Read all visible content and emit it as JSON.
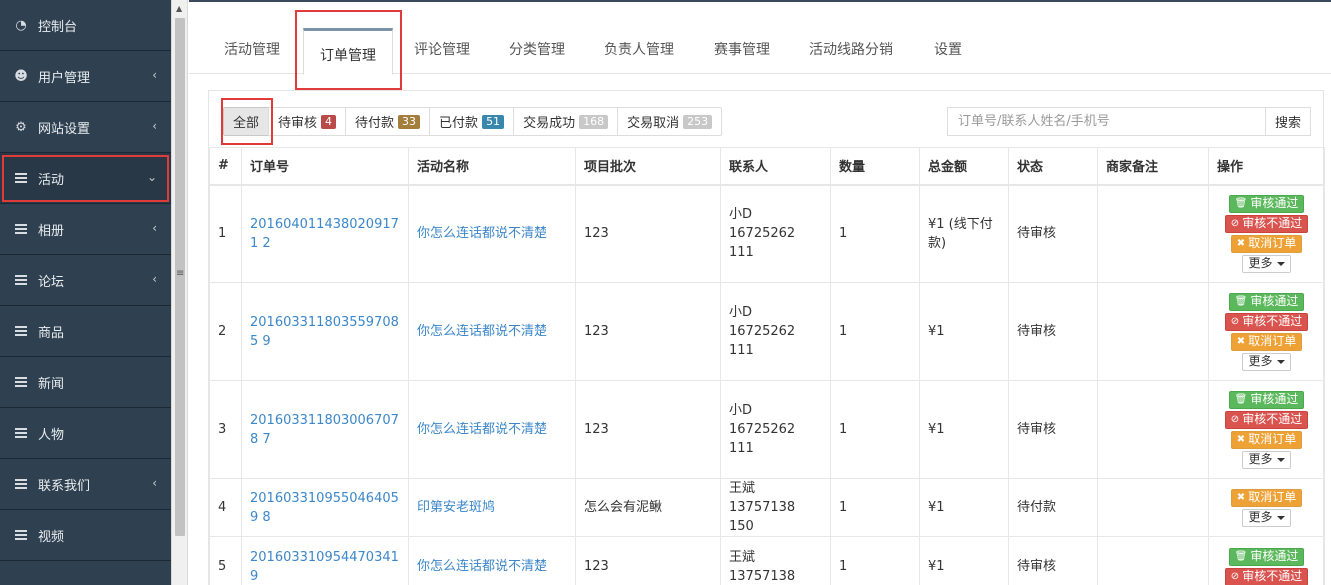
{
  "sidebar": {
    "items": [
      {
        "label": "控制台",
        "icon": "dashboard-icon",
        "has_chevron": false
      },
      {
        "label": "用户管理",
        "icon": "users-icon",
        "has_chevron": true
      },
      {
        "label": "网站设置",
        "icon": "cogs-icon",
        "has_chevron": true
      },
      {
        "label": "活动",
        "icon": "menu-icon",
        "has_chevron": true,
        "expanded": true
      },
      {
        "label": "相册",
        "icon": "menu-icon",
        "has_chevron": true
      },
      {
        "label": "论坛",
        "icon": "menu-icon",
        "has_chevron": true
      },
      {
        "label": "商品",
        "icon": "menu-icon",
        "has_chevron": false
      },
      {
        "label": "新闻",
        "icon": "menu-icon",
        "has_chevron": false
      },
      {
        "label": "人物",
        "icon": "menu-icon",
        "has_chevron": false
      },
      {
        "label": "联系我们",
        "icon": "menu-icon",
        "has_chevron": true
      },
      {
        "label": "视频",
        "icon": "menu-icon",
        "has_chevron": false
      }
    ],
    "chevron_left": "‹",
    "chevron_down": "⌄"
  },
  "tabs": [
    {
      "label": "活动管理"
    },
    {
      "label": "订单管理",
      "active": true
    },
    {
      "label": "评论管理"
    },
    {
      "label": "分类管理"
    },
    {
      "label": "负责人管理"
    },
    {
      "label": "赛事管理"
    },
    {
      "label": "活动线路分销"
    },
    {
      "label": "设置"
    }
  ],
  "filters": [
    {
      "label": "全部",
      "count": null,
      "active": true
    },
    {
      "label": "待审核",
      "count": "4",
      "color": "#b94a48"
    },
    {
      "label": "待付款",
      "count": "33",
      "color": "#a47e3c"
    },
    {
      "label": "已付款",
      "count": "51",
      "color": "#3a87ad"
    },
    {
      "label": "交易成功",
      "count": "168",
      "color": "#c8c8c8"
    },
    {
      "label": "交易取消",
      "count": "253",
      "color": "#c8c8c8"
    }
  ],
  "search": {
    "placeholder": "订单号/联系人姓名/手机号",
    "button_label": "搜索"
  },
  "table": {
    "headers": [
      "#",
      "订单号",
      "活动名称",
      "项目批次",
      "联系人",
      "数量",
      "总金额",
      "状态",
      "商家备注",
      "操作"
    ],
    "rows": [
      {
        "no": "1",
        "order_no": "2016040114380209171 2",
        "activity": "你怎么连话都说不清楚",
        "batch": "123",
        "contact": "小D 16725262 111",
        "qty": "1",
        "amount": "¥1 (线下付款)",
        "status": "待审核",
        "note": "",
        "actions": [
          "approve",
          "reject",
          "cancel",
          "more"
        ]
      },
      {
        "no": "2",
        "order_no": "2016033118035597085 9",
        "activity": "你怎么连话都说不清楚",
        "batch": "123",
        "contact": "小D 16725262 111",
        "qty": "1",
        "amount": "¥1",
        "status": "待审核",
        "note": "",
        "actions": [
          "approve",
          "reject",
          "cancel",
          "more"
        ]
      },
      {
        "no": "3",
        "order_no": "2016033118030067078 7",
        "activity": "你怎么连话都说不清楚",
        "batch": "123",
        "contact": "小D 16725262 111",
        "qty": "1",
        "amount": "¥1",
        "status": "待审核",
        "note": "",
        "actions": [
          "approve",
          "reject",
          "cancel",
          "more"
        ]
      },
      {
        "no": "4",
        "order_no": "2016033109550464059 8",
        "activity": "印第安老斑鸠",
        "batch": "怎么会有泥鳅",
        "contact": "王斌 13757138 150",
        "qty": "1",
        "amount": "¥1",
        "status": "待付款",
        "note": "",
        "actions": [
          "cancel",
          "more"
        ]
      },
      {
        "no": "5",
        "order_no": "2016033109544703419",
        "activity": "你怎么连话都说不清楚",
        "batch": "123",
        "contact": "王斌 13757138",
        "qty": "1",
        "amount": "¥1",
        "status": "待审核",
        "note": "",
        "actions": [
          "approve",
          "reject"
        ]
      }
    ],
    "action_labels": {
      "approve": "审核通过",
      "reject": "审核不通过",
      "cancel": "取消订单",
      "more": "更多"
    }
  },
  "colors": {
    "sidebar_bg": "#2f4050",
    "link": "#3c87c9",
    "approve": "#5cb85c",
    "reject": "#d9534f",
    "cancel": "#eea236",
    "highlight_box": "#e03a3a"
  }
}
